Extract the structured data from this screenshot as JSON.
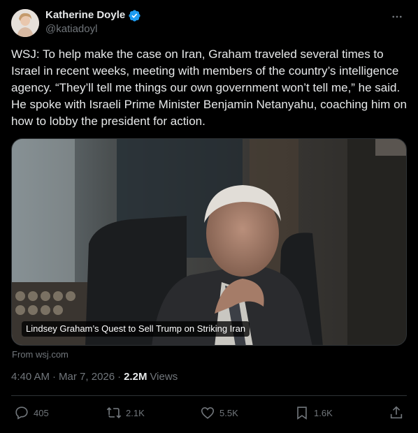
{
  "author": {
    "display_name": "Katherine Doyle",
    "handle": "@katiadoyl",
    "verified": true
  },
  "tweet": {
    "text": "WSJ: To help make the case on Iran, Graham traveled several times to Israel in recent weeks, meeting with members of the country’s intelligence agency. “They’ll tell me things our own government won’t tell me,” he said. He spoke with Israeli Prime Minister Benjamin Netanyahu, coaching him on how to lobby the president for action."
  },
  "card": {
    "caption": "Lindsey Graham’s Quest to Sell Trump on Striking Iran",
    "source": "From wsj.com"
  },
  "meta": {
    "time": "4:40 AM",
    "sep1": "·",
    "date": "Mar 7, 2026",
    "sep2": "·",
    "views_count": "2.2M",
    "views_label": "Views"
  },
  "actions": {
    "replies": "405",
    "reposts": "2.1K",
    "likes": "5.5K",
    "bookmarks": "1.6K"
  },
  "icons": [
    "verified-badge-icon",
    "more-icon",
    "reply-icon",
    "repost-icon",
    "like-icon",
    "bookmark-icon",
    "share-icon"
  ],
  "colors": {
    "background": "#000000",
    "text": "#e7e9ea",
    "muted": "#71767b",
    "verified": "#1d9bf0",
    "border": "#2f3336"
  }
}
